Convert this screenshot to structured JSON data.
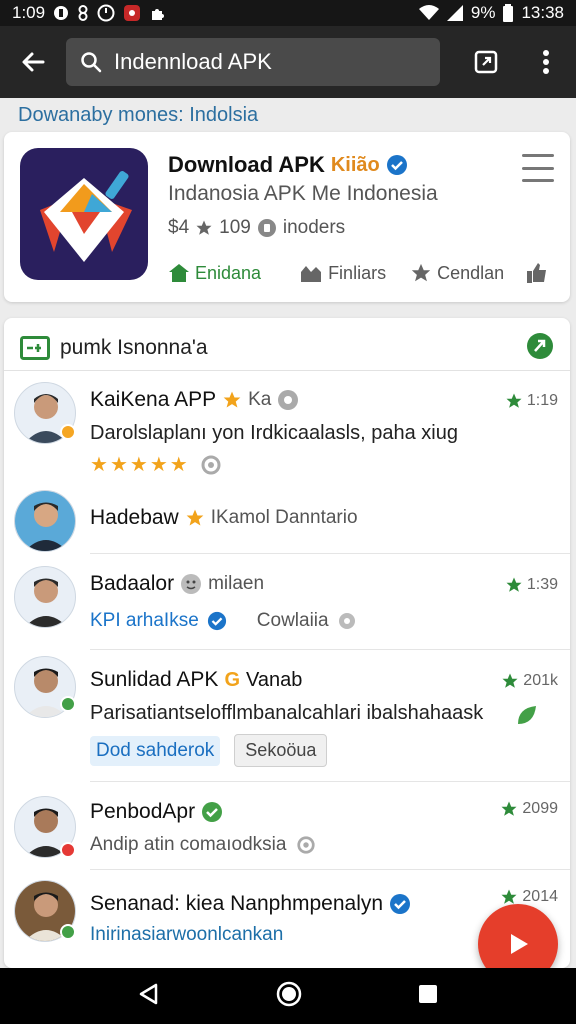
{
  "status_bar": {
    "time_left": "1:09",
    "battery": "9%",
    "time_right": "13:38"
  },
  "app_bar": {
    "search_value": "Indennload APK",
    "icons": [
      "arrow-back-icon",
      "search-icon",
      "open-external-icon",
      "overflow-menu-icon"
    ]
  },
  "breadcrumb": "Dowanaby mones: Indolsia",
  "app_card": {
    "title": "Download APK",
    "title_suffix": "Kiião",
    "subtitle": "Indanosia APK Me Indonesia",
    "meta_price": "$4",
    "meta_rating": "109",
    "meta_installs": "inoders",
    "actions": [
      {
        "label": "Enidana"
      },
      {
        "label": "Finliars"
      },
      {
        "label": "Cendlan"
      }
    ],
    "colors": {
      "icon_bg": "#2a1f5e",
      "primary": "#2e8b3a",
      "verified": "#1b74c9"
    }
  },
  "feed": {
    "header_label": "pumk Isnonna'a",
    "items": [
      {
        "name": "KaiKena APP",
        "name_extra": "Ka",
        "time": "1:19",
        "body": "Darolslaplanı yon Irdkicaalasls, paha xiug",
        "rating_stars": 5,
        "presence": "#f5a623"
      },
      {
        "name": "Hadebaw",
        "name_extra": "IKamol Danntario",
        "time": "",
        "presence": null
      },
      {
        "name": "Badaalor",
        "name_extra": "milaen",
        "time": "1:39",
        "link": "KPI arhaIkse",
        "secondary": "Cowlaiia",
        "presence": null
      },
      {
        "name": "Sunlidad APK",
        "name_extra": "Vanab",
        "time": "201k",
        "body": "Parisatiantselofflmbanalcahlari ibalshahaask",
        "chip_blue": "Dod sahderok",
        "chip_gray": "Sekoöua",
        "presence": "#43a047"
      },
      {
        "name": "PenbodApr",
        "time": "2099",
        "body": "Andip atin comaıodksia",
        "presence": "#e53935"
      },
      {
        "name": "Senanad: kiea Nanphmpenalyn",
        "time": "2014",
        "body": "Inirinasiarwoonlcankan",
        "presence": "#43a047"
      }
    ]
  },
  "fab": {
    "icon": "play-icon",
    "color": "#e53e2b"
  },
  "nav": [
    "back-nav-icon",
    "home-nav-icon",
    "recents-nav-icon"
  ]
}
